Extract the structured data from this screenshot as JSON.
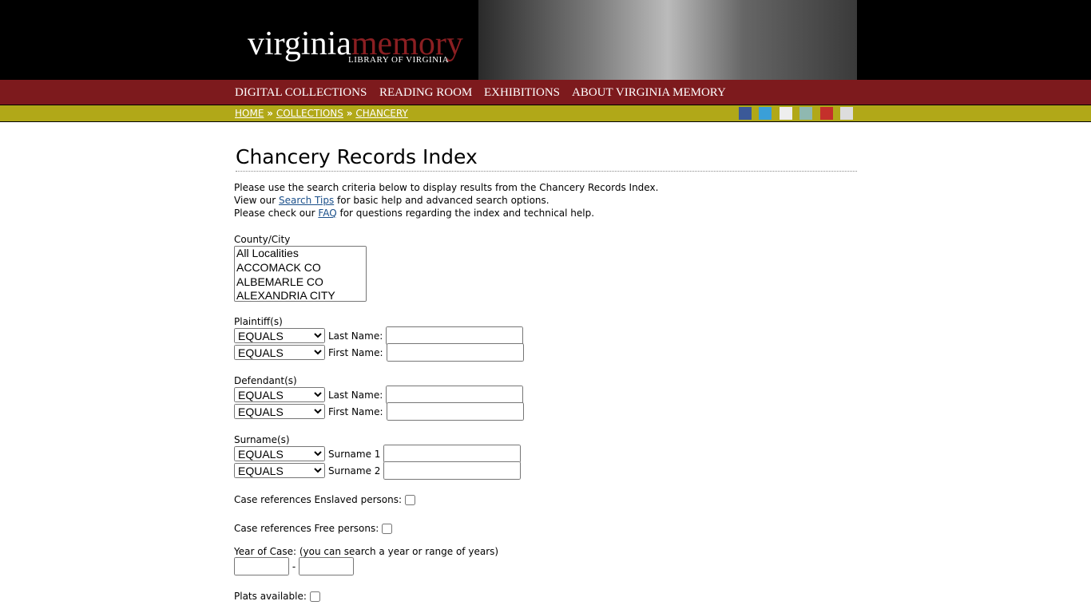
{
  "header": {
    "logo_a": "virginia",
    "logo_b": "memory",
    "logo_sub": "LIBRARY OF VIRGINIA"
  },
  "nav": [
    "DIGITAL COLLECTIONS",
    "READING ROOM",
    "EXHIBITIONS",
    "ABOUT VIRGINIA MEMORY"
  ],
  "breadcrumb": [
    "HOME",
    "COLLECTIONS",
    "CHANCERY"
  ],
  "sep": "»",
  "social": [
    "facebook",
    "twitter",
    "flickr",
    "blog",
    "youtube",
    "google"
  ],
  "title": "Chancery Records Index",
  "intro": {
    "l1": "Please use the search criteria below to display results from the Chancery Records Index.",
    "l2a": "View our ",
    "l2link": "Search Tips",
    "l2b": " for basic help and advanced search options.",
    "l3a": "Please check our ",
    "l3link": "FAQ",
    "l3b": " for questions regarding the index and technical help."
  },
  "county": {
    "label": "County/City",
    "options": [
      "All Localities",
      "ACCOMACK CO",
      "ALBEMARLE CO",
      "ALEXANDRIA CITY"
    ]
  },
  "op": "EQUALS",
  "plaintiff": {
    "label": "Plaintiff(s)",
    "last": "Last Name:",
    "first": "First Name:"
  },
  "defendant": {
    "label": "Defendant(s)",
    "last": "Last Name:",
    "first": "First Name:"
  },
  "surname": {
    "label": "Surname(s)",
    "s1": "Surname 1",
    "s2": "Surname 2"
  },
  "enslaved": "Case references Enslaved persons:",
  "free": "Case references Free persons:",
  "year": {
    "label": "Year of Case: (you can search a year or range of years)",
    "dash": "-"
  },
  "plats": "Plats available:"
}
